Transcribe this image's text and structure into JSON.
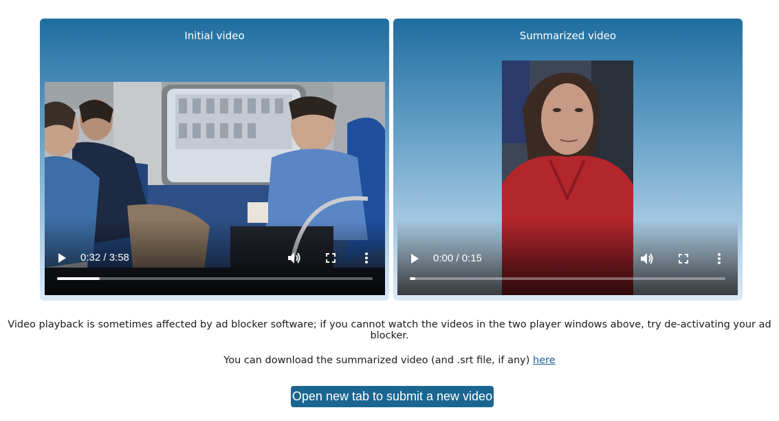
{
  "players": [
    {
      "title": "Initial video",
      "time": "0:32 / 3:58",
      "progress": 0.1345
    },
    {
      "title": "Summarized video",
      "time": "0:00 / 0:15",
      "progress": 0.0
    }
  ],
  "notice": "Video playback is sometimes affected by ad blocker software; if you cannot watch the videos in the two player windows above, try de-activating your ad blocker.",
  "download": {
    "text": "You can download the summarized video (and .srt file, if any)",
    "link_label": "here"
  },
  "submit_button": "Open new tab to submit a new video",
  "colors": {
    "panel_top": "#1f6e9f",
    "panel_bottom": "#dbeaf7",
    "button": "#1b6691",
    "link": "#1a5c9a"
  },
  "icons": [
    "play-icon",
    "volume-icon",
    "fullscreen-icon",
    "more-vert-icon"
  ]
}
